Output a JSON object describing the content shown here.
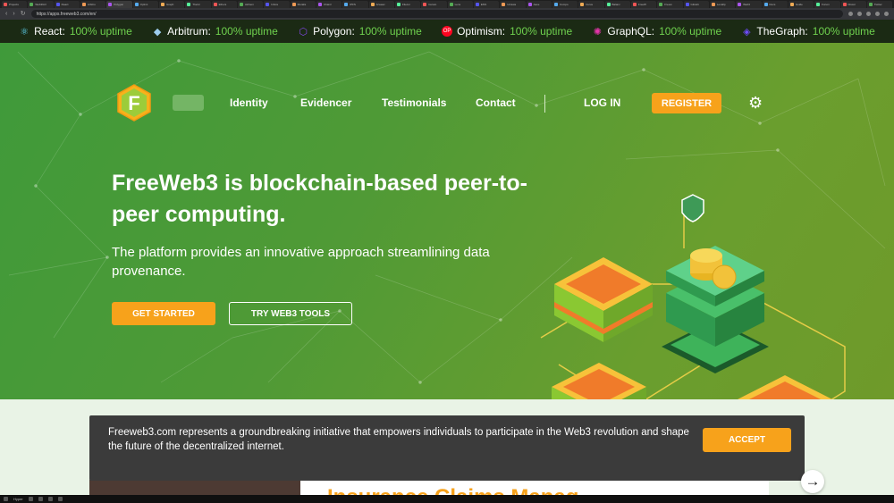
{
  "browser": {
    "tabs": [
      "Projects",
      "Web3GO",
      "React",
      "Arbitru",
      "Polygon",
      "Optimi",
      "Graph",
      "TheGr",
      "Ethers",
      "Alchem",
      "Infura",
      "Moralis",
      "Chainl",
      "IPFS",
      "Arweav",
      "Filecoi",
      "Ceram",
      "Lens",
      "ENS",
      "Uniswa",
      "Aave",
      "Compo",
      "Curve",
      "Balanc",
      "FreeW",
      "Freew",
      "GitHub",
      "LocalIp",
      "Web3",
      "Docs",
      "Guide",
      "Forum",
      "Discor",
      "Twitter"
    ],
    "url": "https://apps.freeweb3.com/en/"
  },
  "ticker": [
    {
      "name": "React:",
      "status": "100% uptime",
      "icon": "react-icon",
      "color": "#61dafb"
    },
    {
      "name": "Arbitrum:",
      "status": "100% uptime",
      "icon": "arbitrum-icon",
      "color": "#9dcced"
    },
    {
      "name": "Polygon:",
      "status": "100% uptime",
      "icon": "polygon-icon",
      "color": "#8247e5"
    },
    {
      "name": "Optimism:",
      "status": "100% uptime",
      "icon": "optimism-icon",
      "color": "#ff0420"
    },
    {
      "name": "GraphQL:",
      "status": "100% uptime",
      "icon": "graphql-icon",
      "color": "#e535ab"
    },
    {
      "name": "TheGraph:",
      "status": "100% uptime",
      "icon": "thegraph-icon",
      "color": "#6f4cff"
    }
  ],
  "nav": {
    "items": [
      "Identity",
      "Evidencer",
      "Testimonials",
      "Contact"
    ],
    "login": "LOG IN",
    "register": "REGISTER",
    "logo_letter": "F"
  },
  "hero": {
    "headline": "FreeWeb3 is blockchain-based peer-to-peer computing.",
    "subtitle": "The platform provides an innovative approach streamlining data provenance.",
    "cta_primary": "GET STARTED",
    "cta_secondary": "TRY WEB3 TOOLS"
  },
  "lower": {
    "peek_heading": "Insurance Claims Manag"
  },
  "cookie": {
    "text": "Freeweb3.com represents a groundbreaking initiative that empowers individuals to participate in the Web3 revolution and shape the future of the decentralized internet.",
    "accept": "ACCEPT"
  },
  "colors": {
    "accent": "#f7a21b",
    "uptime": "#6fd14e",
    "hero_green": "#4f9a36"
  },
  "taskbar": {
    "start": "Hyper"
  }
}
